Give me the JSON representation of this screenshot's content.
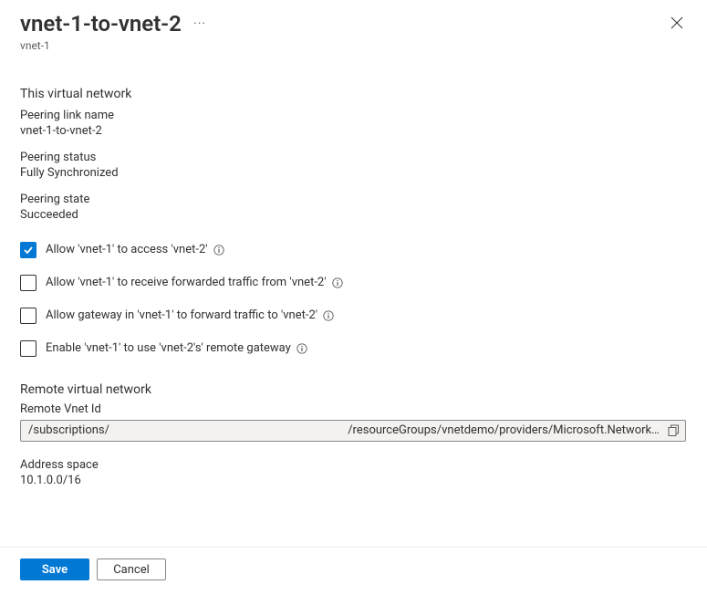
{
  "header": {
    "title": "vnet-1-to-vnet-2",
    "subtitle": "vnet-1"
  },
  "thisVnet": {
    "heading": "This virtual network",
    "peeringLinkName": {
      "label": "Peering link name",
      "value": "vnet-1-to-vnet-2"
    },
    "peeringStatus": {
      "label": "Peering status",
      "value": "Fully Synchronized"
    },
    "peeringState": {
      "label": "Peering state",
      "value": "Succeeded"
    }
  },
  "options": {
    "allowAccess": {
      "label": "Allow 'vnet-1' to access 'vnet-2'",
      "checked": true
    },
    "allowForwarded": {
      "label": "Allow 'vnet-1' to receive forwarded traffic from 'vnet-2'",
      "checked": false
    },
    "allowGateway": {
      "label": "Allow gateway in 'vnet-1' to forward traffic to 'vnet-2'",
      "checked": false
    },
    "useRemoteGateway": {
      "label": "Enable 'vnet-1' to use 'vnet-2's' remote gateway",
      "checked": false
    }
  },
  "remote": {
    "heading": "Remote virtual network",
    "remoteVnetId": {
      "label": "Remote Vnet Id",
      "value": "/subscriptions/                                                                                 /resourceGroups/vnetdemo/providers/Microsoft.Network/virtu…"
    },
    "addressSpace": {
      "label": "Address space",
      "value": "10.1.0.0/16"
    }
  },
  "footer": {
    "save": "Save",
    "cancel": "Cancel"
  }
}
